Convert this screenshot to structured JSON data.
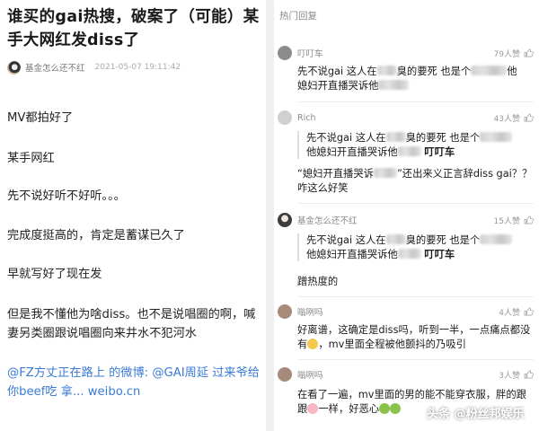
{
  "post": {
    "title": "谁买的gai热搜，破案了（可能）某手大网红发diss了",
    "author": "基金怎么还不红",
    "time": "2021-05-07 19:11:42",
    "paragraphs": [
      "MV都拍好了",
      "某手网红",
      "先不说好听不好听。。。",
      "完成度挺高的，肯定是蓄谋已久了",
      "早就写好了现在发",
      "但是我不懂他为啥diss。也不是说唱圈的啊，喊妻另类圈跟说唱圈向来井水不犯河水"
    ],
    "link_text": "@FZ方丈正在路上 的微博: @GAI周延 过来爷给你beef吃 拿... weibo.cn"
  },
  "comments_header": "热门回复",
  "comments": [
    {
      "name": "叮叮车",
      "likes": "79人赞",
      "avatar_color": "#8c8c8c",
      "body_a": "先不说gai 这人在",
      "body_b": "臭的要死 也是个",
      "body_c": "他",
      "body_d": "媳妇开直播哭诉他"
    },
    {
      "name": "Rich",
      "likes": "43人赞",
      "avatar_color": "#bdbdbd",
      "quote_a": "先不说gai 这人在",
      "quote_b": "臭的要死 也是个",
      "quote_c": "他媳妇开直播哭诉他",
      "quote_author": "叮叮车",
      "reply": "“媳妇开直播哭诉",
      "reply_b": "”还出来义正言辞diss gai？？咋这么好笑"
    },
    {
      "name": "基金怎么还不红",
      "likes": "15人赞",
      "avatar_color": "#4a4a4a",
      "quote_a": "先不说gai 这人在",
      "quote_b": "臭的要死 也是个",
      "quote_c": "他媳妇开直播哭诉他",
      "quote_author": "叮叮车",
      "reply": "蹭热度的"
    },
    {
      "name": "嗡咧吗",
      "likes": "4人赞",
      "avatar_color": "#a88a7a",
      "body": "好离谱，这确定是diss吗，听到一半，一点痛点都没有",
      "body_tail": "，mv里面全程被他颤抖的乃吸引"
    },
    {
      "name": "嗡咧吗",
      "likes": "3人赞",
      "avatar_color": "#a88a7a",
      "body": "在看了一遍，mv里面的男的能不能穿衣服，胖的跟",
      "body_tail": "一样，好恶心"
    }
  ],
  "watermark": "头条 @粉丝邦娱乐",
  "colors": {
    "link": "#3a7bd5",
    "divider": "#f0f0f0",
    "meta_text": "#888888"
  }
}
